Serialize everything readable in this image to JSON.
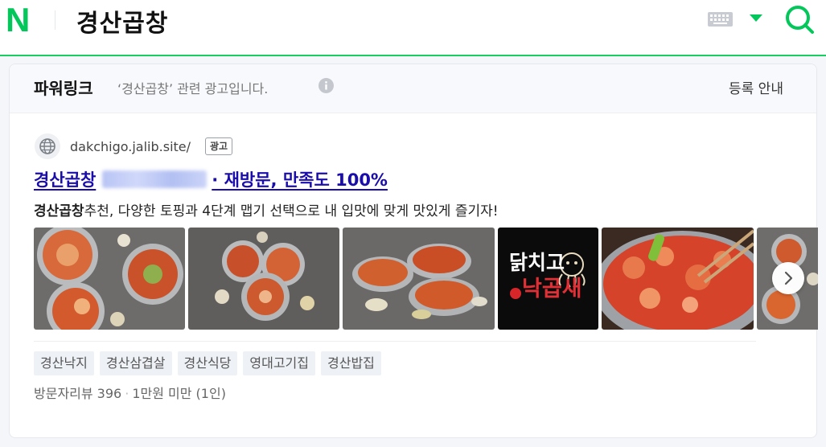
{
  "header": {
    "logo": "N",
    "query": "경산곱창",
    "brand_color": "#03c75a"
  },
  "powerlink": {
    "title": "파워링크",
    "description": "‘경산곱창’ 관련 광고입니다.",
    "register_label": "등록 안내"
  },
  "ad": {
    "site_url": "dakchigo.jalib.site/",
    "badge": "광고",
    "title_prefix": "경산곱창",
    "title_suffix": "· 재방문, 만족도 100%",
    "description_bold": "경산곱창",
    "description_rest": "추천, 다양한 토핑과 4단계 맵기 선택으로 내 입맛에 맞게 맛있게 즐기자!",
    "brand_logo_text_top": "닭치고",
    "brand_logo_text_bottom": "낙곱새",
    "tags": [
      "경산낙지",
      "경산삼겹살",
      "경산식당",
      "영대고기집",
      "경산밥집"
    ],
    "review_label": "방문자리뷰 396",
    "price_label": "1만원 미만 (1인)"
  },
  "icons": [
    "keyboard-icon",
    "dropdown-caret-icon",
    "search-icon",
    "info-icon",
    "globe-icon",
    "chevron-right-icon"
  ]
}
